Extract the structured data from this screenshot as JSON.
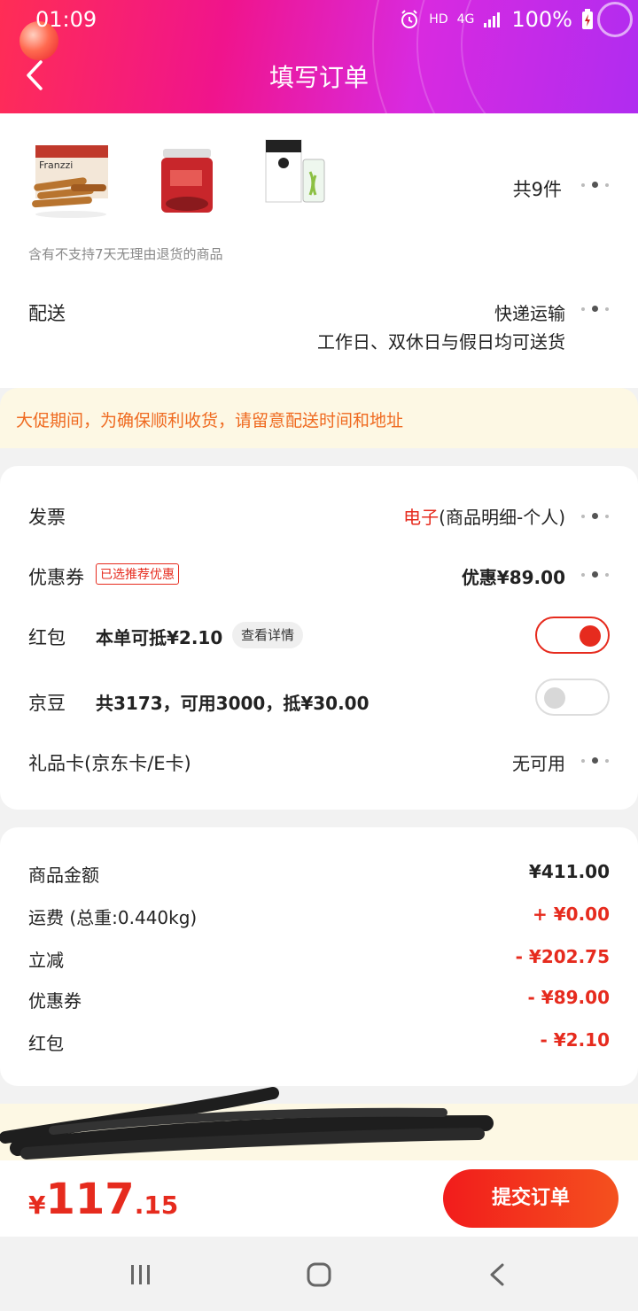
{
  "status_bar": {
    "time": "01:09",
    "hd": "HD",
    "network": "4G",
    "battery": "100%"
  },
  "header": {
    "title": "填写订单"
  },
  "products": {
    "count": "共9件",
    "images": [
      "franzzi-cookies-image",
      "red-jar-image",
      "tea-box-image"
    ],
    "box_brand": "Franzzi",
    "notice": "含有不支持7天无理由退货的商品"
  },
  "delivery": {
    "label": "配送",
    "method": "快递运输",
    "schedule": "工作日、双休日与假日均可送货"
  },
  "promo_banner": {
    "text": "大促期间，为确保顺利收货，请留意配送时间和地址"
  },
  "invoice": {
    "label": "发票",
    "type": "电子",
    "detail": "(商品明细-个人)"
  },
  "coupon": {
    "label": "优惠券",
    "tag": "已选推荐优惠",
    "value": "优惠¥89.00"
  },
  "red_packet": {
    "label": "红包",
    "desc": "本单可抵¥2.10",
    "detail_btn": "查看详情",
    "enabled": true
  },
  "jingdou": {
    "label": "京豆",
    "desc": "共3173，可用3000，抵¥30.00",
    "enabled": false
  },
  "gift_card": {
    "label": "礼品卡(京东卡/E卡)",
    "value": "无可用"
  },
  "summary": {
    "rows": [
      {
        "label": "商品金额",
        "value": "¥411.00"
      },
      {
        "label": "运费 (总重:0.440kg)",
        "value": "+ ¥0.00"
      },
      {
        "label": "立减",
        "value": "- ¥202.75"
      },
      {
        "label": "优惠券",
        "value": "- ¥89.00"
      },
      {
        "label": "红包",
        "value": "- ¥2.10"
      }
    ]
  },
  "footer": {
    "currency": "¥",
    "total_int": "117",
    "total_dec": ".15",
    "submit": "提交订单"
  },
  "colors": {
    "accent": "#e62b1e",
    "banner_text": "#ef6a20",
    "banner_bg": "#fdf8e4"
  }
}
